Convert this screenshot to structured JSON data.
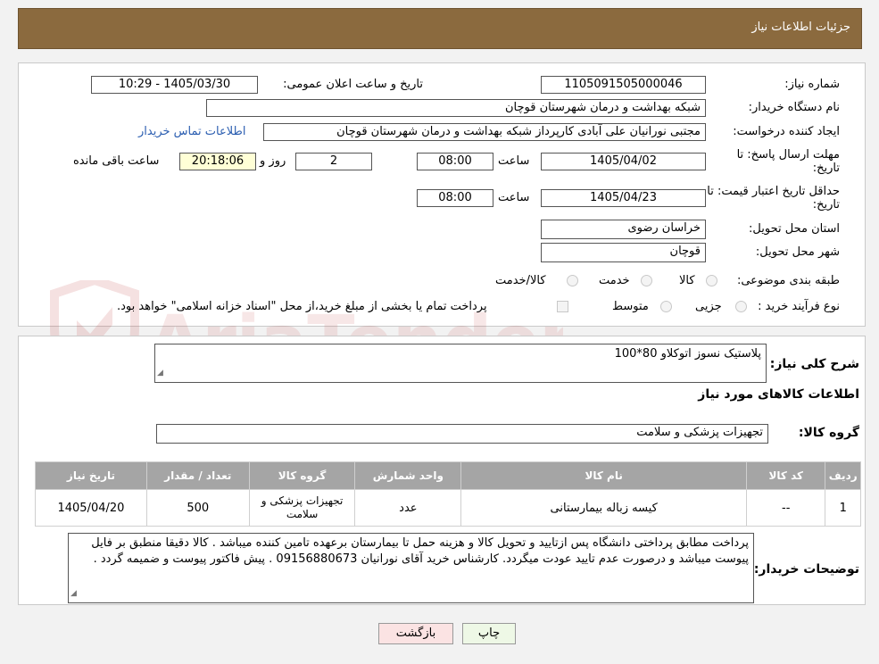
{
  "header": {
    "title": "جزئیات اطلاعات نیاز"
  },
  "watermark": {
    "text": "AriaTender.neT"
  },
  "form": {
    "need_number": {
      "label": "شماره نیاز:",
      "value": "1105091505000046"
    },
    "announce_datetime": {
      "label": "تاریخ و ساعت اعلان عمومی:",
      "value": "1405/03/30 - 10:29"
    },
    "buyer_org": {
      "label": "نام دستگاه خریدار:",
      "value": "شبکه بهداشت و درمان شهرستان قوچان"
    },
    "requester": {
      "label": "ایجاد کننده درخواست:",
      "value": "مجتبی نورانیان علی آبادی کارپرداز شبکه بهداشت و درمان شهرستان قوچان",
      "contact_link": "اطلاعات تماس خریدار"
    },
    "reply_deadline": {
      "label": "مهلت ارسال پاسخ: تا تاریخ:",
      "date": "1405/04/02",
      "time_label": "ساعت",
      "time": "08:00",
      "days": "2",
      "days_label": "روز و",
      "remaining": "20:18:06",
      "remaining_label": "ساعت باقی مانده"
    },
    "price_validity": {
      "label": "حداقل تاریخ اعتبار قیمت: تا تاریخ:",
      "date": "1405/04/23",
      "time_label": "ساعت",
      "time": "08:00"
    },
    "province": {
      "label": "استان محل تحویل:",
      "value": "خراسان رضوی"
    },
    "city": {
      "label": "شهر محل تحویل:",
      "value": "قوچان"
    },
    "category": {
      "label": "طبقه بندی موضوعی:",
      "options": [
        "کالا",
        "خدمت",
        "کالا/خدمت"
      ]
    },
    "process_type": {
      "label": "نوع فرآیند خرید :",
      "options": [
        "جزیی",
        "متوسط"
      ],
      "note": "پرداخت تمام یا بخشی از مبلغ خرید،از محل \"اسناد خزانه اسلامی\" خواهد بود."
    }
  },
  "details": {
    "general_desc": {
      "label": "شرح کلی نیاز:",
      "value": "پلاستیک نسوز اتوکلاو 80*100"
    },
    "goods_info_title": "اطلاعات کالاهای مورد نیاز",
    "goods_group": {
      "label": "گروه کالا:",
      "value": "تجهیزات پزشکی و سلامت"
    },
    "table": {
      "headers": [
        "ردیف",
        "کد کالا",
        "نام کالا",
        "واحد شمارش",
        "گروه کالا",
        "تعداد / مقدار",
        "تاریخ نیاز"
      ],
      "rows": [
        [
          "1",
          "--",
          "کیسه زباله بیمارستانی",
          "عدد",
          "تجهیزات پزشکی و سلامت",
          "500",
          "1405/04/20"
        ]
      ]
    },
    "buyer_notes": {
      "label": "توضیحات خریدار:",
      "value": "پرداخت مطابق پرداختی دانشگاه پس ازتایید و تحویل کالا  و هزینه حمل تا بیمارستان برعهده تامین کننده میباشد . کالا دقیقا منطبق بر فایل پیوست میباشد و درصورت عدم تایید عودت میگردد. کارشناس خرید آقای نورانیان 09156880673 . پیش فاکتور پیوست و ضمیمه گردد ."
    }
  },
  "buttons": {
    "print": "چاپ",
    "back": "بازگشت"
  },
  "colors": {
    "header": "#8b6a3e",
    "table_header": "#a5a5a5",
    "remaining_bg": "#ffffd6",
    "back_btn": "#fbe3e3",
    "print_btn": "#eef8e6",
    "link": "#2a5db0"
  }
}
